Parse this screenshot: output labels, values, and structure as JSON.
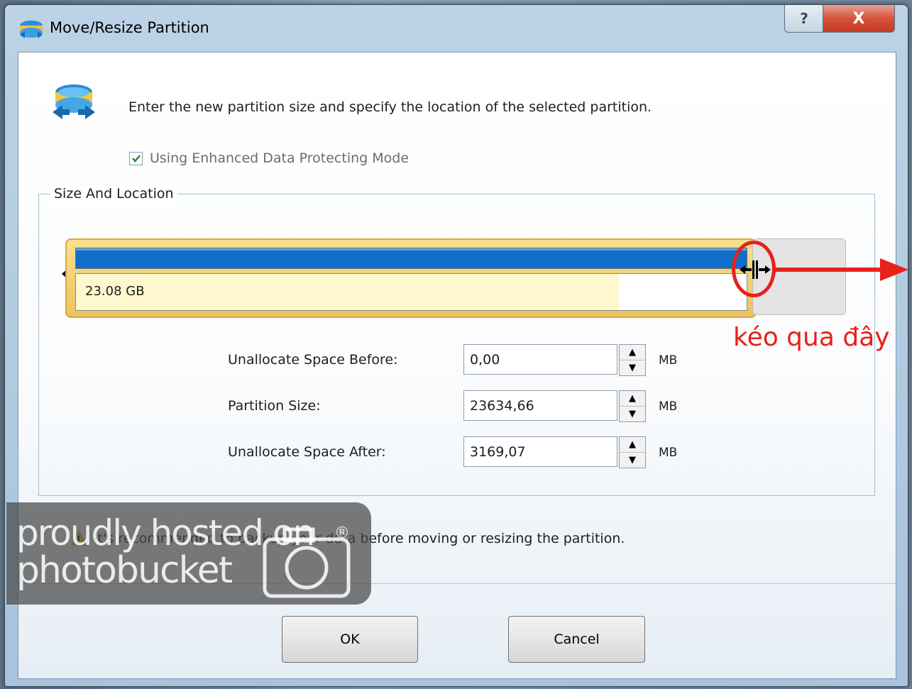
{
  "window": {
    "title": "Move/Resize Partition",
    "help_label": "?",
    "close_label": "X"
  },
  "header": {
    "instruction": "Enter the new partition size and specify the location of the selected partition."
  },
  "options": {
    "enhanced_mode_label": "Using Enhanced Data Protecting Mode",
    "enhanced_mode_checked": true
  },
  "size_location": {
    "group_title": "Size And Location",
    "partition_bar_label": "23.08 GB",
    "partition_used_fraction": 0.81
  },
  "fields": {
    "before_label": "Unallocate Space Before:",
    "before_value": "0,00",
    "before_unit": "MB",
    "size_label": "Partition Size:",
    "size_value": "23634,66",
    "size_unit": "MB",
    "after_label": "Unallocate Space After:",
    "after_value": "3169,07",
    "after_unit": "MB"
  },
  "warning": {
    "text": "It's recommended to backup your data before moving or resizing the partition."
  },
  "buttons": {
    "ok_label": "OK",
    "cancel_label": "Cancel"
  },
  "watermark": {
    "line1": "proudly hosted on",
    "line2": "photobucket",
    "registered": "®"
  },
  "annotation": {
    "text": "kéo qua đây",
    "color": "#e8211a"
  },
  "colors": {
    "bar_blue": "#0d6fc7",
    "bar_gold": "#ecc45e",
    "used_fill": "#fff8cf"
  }
}
